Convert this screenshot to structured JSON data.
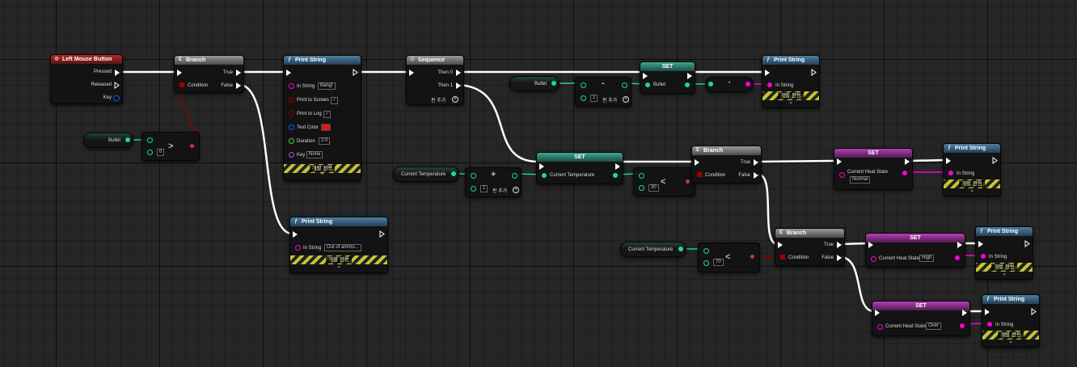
{
  "events": {
    "left_mouse_button": {
      "title": "Left Mouse Button",
      "pressed": "Pressed",
      "released": "Released",
      "key": "Key"
    }
  },
  "branch": {
    "title": "Branch",
    "condition": "Condition",
    "true": "True",
    "false": "False"
  },
  "bullet_var": "Bullet",
  "current_temp_var": "Current Temperature",
  "current_heat_state": "Current Heat State",
  "greater_node": {
    "op": ">",
    "value": "0"
  },
  "print_string": {
    "title": "Print String",
    "in_string": "In String",
    "print_to_screen": "Print to Screen",
    "print_to_log": "Print to Log",
    "text_color": "Text Color",
    "duration": "Duration",
    "key": "Key",
    "dev_only": "개발 전용"
  },
  "print1": {
    "in_string": "Bang!",
    "duration": "2.0",
    "key": "None",
    "check_mark": "✓",
    "text_color_hex": "#e01a1a"
  },
  "print2": {
    "in_string": "Out of ammo..."
  },
  "sequence": {
    "title": "Sequence",
    "then0": "Then 0",
    "then1": "Then 1",
    "add_pin": "핀 추가"
  },
  "set": {
    "title": "SET"
  },
  "decrement": {
    "op": "-",
    "value": "1",
    "add_pin": "핀 추가"
  },
  "increment": {
    "op": "+",
    "value": "1",
    "add_pin": "핀 추가"
  },
  "convert_dot": "•",
  "less30": {
    "op": "<",
    "value": "30"
  },
  "less70": {
    "op": "<",
    "value": "70"
  },
  "heat_states": {
    "normal": "Normal",
    "high": "High",
    "over": "Over"
  },
  "colors": {
    "exec": "#ffffff",
    "int": "#1fd4a4",
    "bool": "#8c0000",
    "string": "#ff00d4",
    "struct": "#0a5cff",
    "linear_color": "#b04dff",
    "float": "#47d448"
  }
}
